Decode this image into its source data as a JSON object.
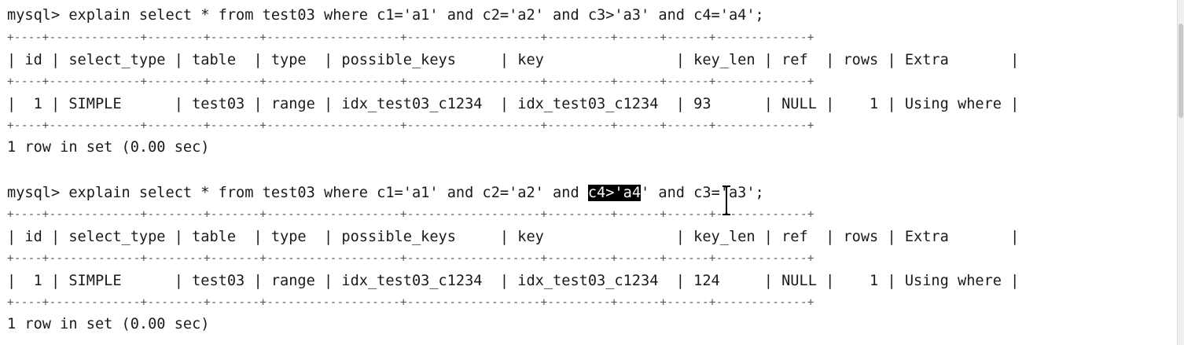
{
  "prompt": "mysql>",
  "queries": [
    {
      "sql": " explain select * from test03 where c1='a1' and c2='a2' and c3>'a3' and c4='a4';",
      "border": "+----+-------------+--------+-------+-------------------+-------------------+---------+------+------+-------------+",
      "header": "| id | select_type | table  | type  | possible_keys     | key               | key_len | ref  | rows | Extra       |",
      "row": "|  1 | SIMPLE      | test03 | range | idx_test03_c1234  | idx_test03_c1234  | 93      | NULL |    1 | Using where |",
      "result": "1 row in set (0.00 sec)"
    },
    {
      "sql_before": " explain select * from test03 where c1='a1' and c2='a2' and ",
      "sql_selected": "c4>'a4",
      "sql_after": "' and c3='a3';",
      "border": "+----+-------------+--------+-------+-------------------+-------------------+---------+------+------+-------------+",
      "header": "| id | select_type | table  | type  | possible_keys     | key               | key_len | ref  | rows | Extra       |",
      "row": "|  1 | SIMPLE      | test03 | range | idx_test03_c1234  | idx_test03_c1234  | 124     | NULL |    1 | Using where |",
      "result": "1 row in set (0.00 sec)"
    }
  ],
  "colors": {
    "background": "#ffffff",
    "text": "#1a1a1a",
    "selection_bg": "#000000",
    "selection_fg": "#ffffff"
  },
  "icons": {
    "cursor": "text-cursor-icon"
  }
}
